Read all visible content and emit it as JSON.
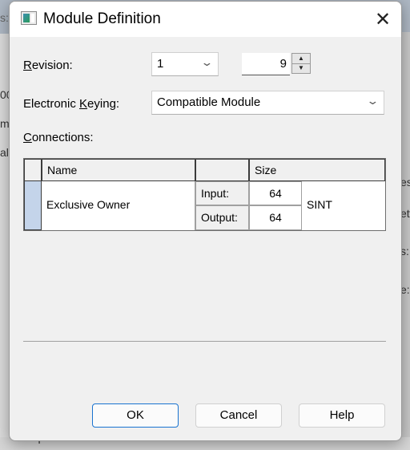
{
  "background": {
    "fragments": [
      "s:",
      "00",
      "m",
      "alE",
      "es",
      "etw",
      "s:",
      "e:",
      "Compatible Module"
    ]
  },
  "dialog": {
    "title": "Module Definition",
    "icon": "module-window-icon",
    "close_icon": "close-icon",
    "revision": {
      "label_accel": "R",
      "label_rest": "evision:",
      "major_value": "1",
      "minor_value": "9"
    },
    "keying": {
      "label_pre": "Electronic ",
      "label_accel": "K",
      "label_rest": "eying:",
      "value": "Compatible Module"
    },
    "connections": {
      "label_accel": "C",
      "label_rest": "onnections:",
      "columns": [
        "",
        "Name",
        "",
        "Size",
        ""
      ],
      "rows": [
        {
          "name": "Exclusive Owner",
          "input_label": "Input:",
          "input_size": "64",
          "output_label": "Output:",
          "output_size": "64",
          "type": "SINT"
        }
      ]
    },
    "buttons": {
      "ok": "OK",
      "cancel": "Cancel",
      "help": "Help"
    }
  }
}
